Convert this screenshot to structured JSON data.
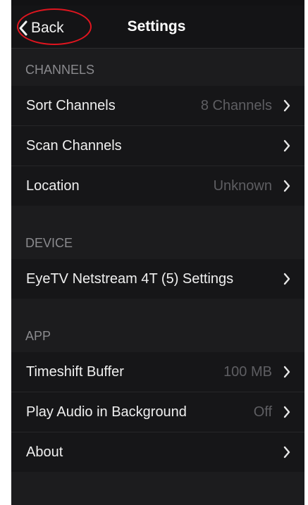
{
  "nav": {
    "back_label": "Back",
    "title": "Settings"
  },
  "sections": [
    {
      "header": "CHANNELS",
      "rows": [
        {
          "label": "Sort Channels",
          "value": "8 Channels"
        },
        {
          "label": "Scan Channels",
          "value": ""
        },
        {
          "label": "Location",
          "value": "Unknown"
        }
      ]
    },
    {
      "header": "DEVICE",
      "rows": [
        {
          "label": "EyeTV Netstream 4T (5) Settings",
          "value": ""
        }
      ]
    },
    {
      "header": "APP",
      "rows": [
        {
          "label": "Timeshift Buffer",
          "value": "100 MB"
        },
        {
          "label": "Play Audio in Background",
          "value": "Off"
        },
        {
          "label": "About",
          "value": ""
        }
      ]
    }
  ],
  "icons": {
    "back": "chevron-left-icon",
    "row_disclosure": "chevron-right-icon"
  },
  "colors": {
    "background": "#1c1c1e",
    "row_background": "#161618",
    "section_text": "#8a8a8e",
    "value_text": "#5e5e62",
    "annotation_circle": "#e0151f"
  }
}
